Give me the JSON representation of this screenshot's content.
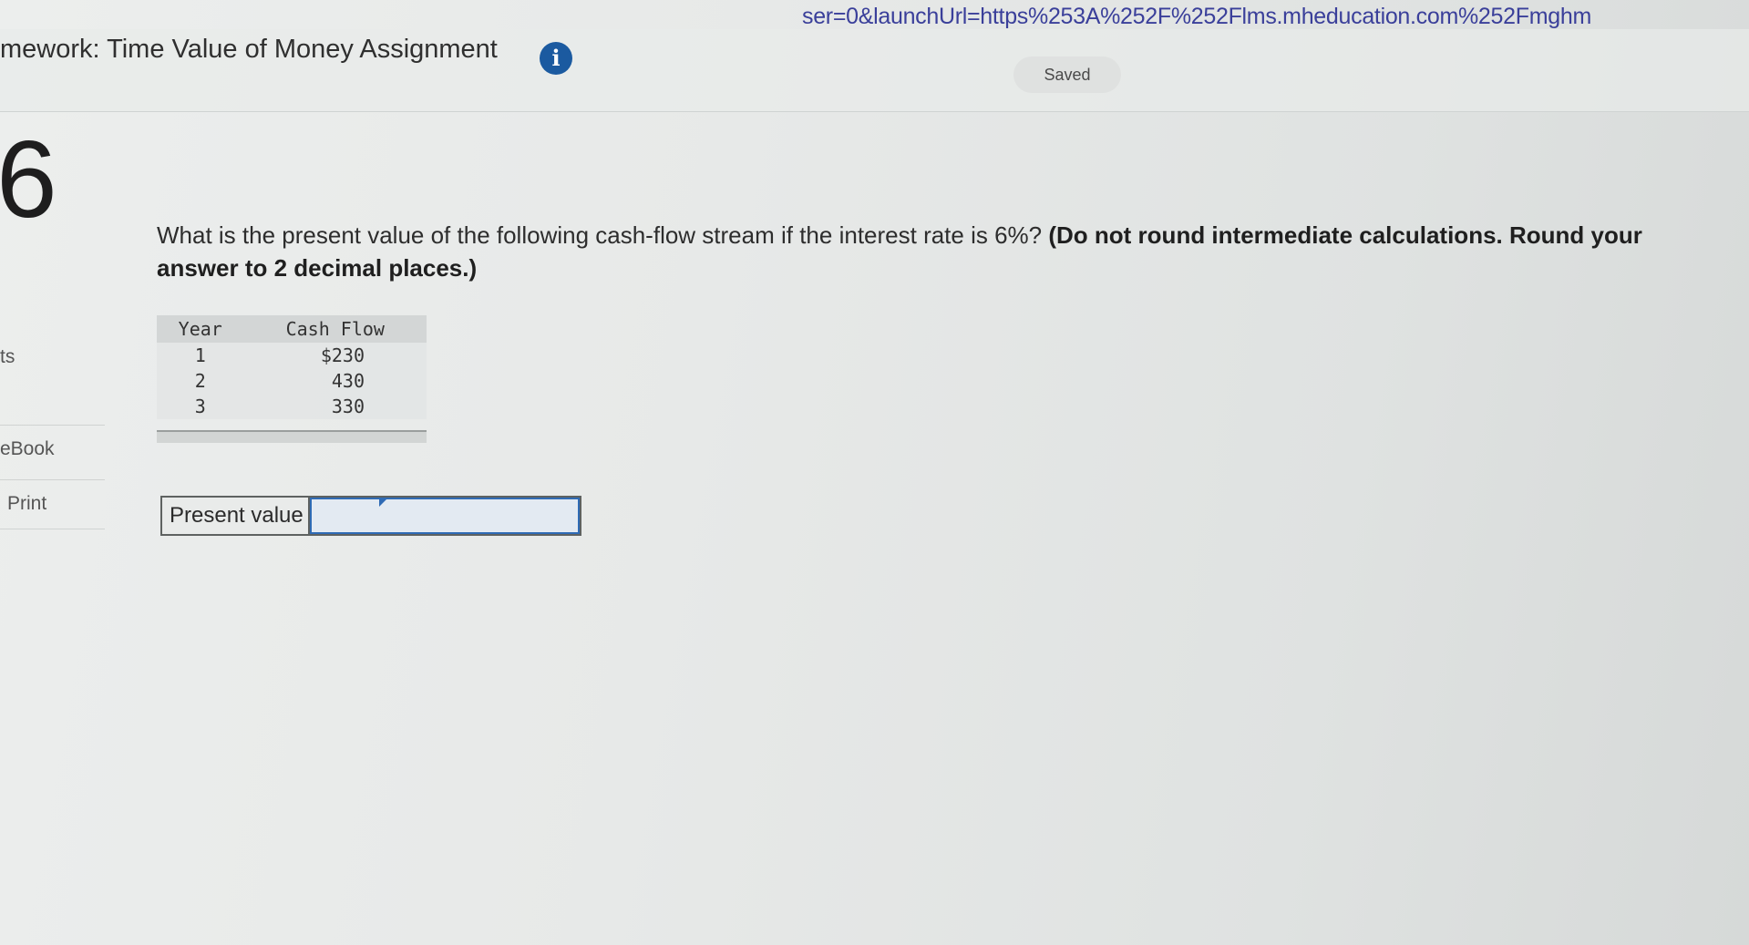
{
  "browser": {
    "url": "ser=0&launchUrl=https%253A%252F%252Flms.mheducation.com%252Fmghm"
  },
  "header": {
    "title": "mework: Time Value of Money Assignment",
    "info_icon": "info-icon",
    "status": "Saved"
  },
  "sidebar": {
    "question_number": "6",
    "items": [
      {
        "label": "ts"
      },
      {
        "label": "eBook"
      },
      {
        "label": "Print"
      }
    ]
  },
  "question": {
    "text": "What is the present value of the following cash-flow stream if the interest rate is 6%?",
    "instruction": "(Do not round intermediate calculations. Round your answer to 2 decimal places.)"
  },
  "table": {
    "headers": [
      "Year",
      "Cash Flow"
    ],
    "rows": [
      {
        "year": "1",
        "cash_flow": "$230"
      },
      {
        "year": "2",
        "cash_flow": "430"
      },
      {
        "year": "3",
        "cash_flow": "330"
      }
    ]
  },
  "answer": {
    "label": "Present value",
    "value": ""
  },
  "colors": {
    "accent": "#1b5aa0",
    "input_border": "#2f6bb5"
  }
}
